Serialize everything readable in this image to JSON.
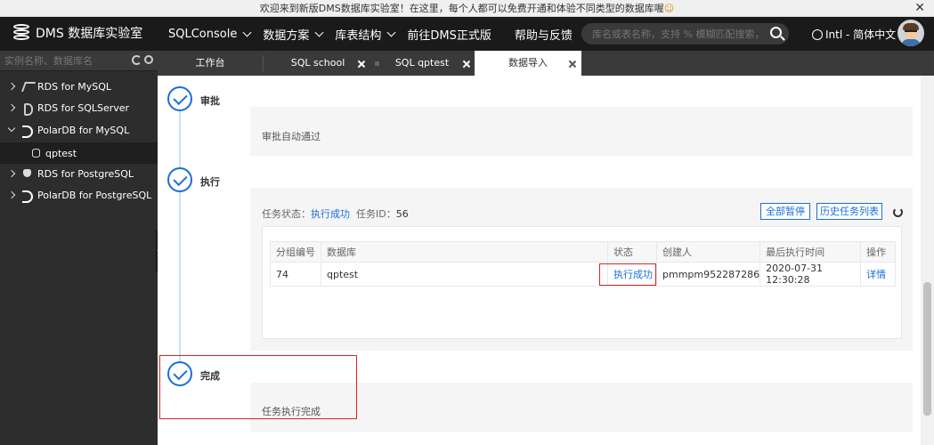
{
  "banner": {
    "text": "欢迎来到新版DMS数据库实验室！在这里，每个人都可以免费开通和体验不同类型的数据库喔",
    "emoji": "☺",
    "close": "✕"
  },
  "nav": {
    "logo": "DMS 数据库实验室",
    "items": [
      {
        "label": "SQLConsole"
      },
      {
        "label": "数据方案"
      },
      {
        "label": "库表结构"
      },
      {
        "label": "前往DMS正式版"
      },
      {
        "label": "帮助与反馈"
      }
    ],
    "search_placeholder": "库名或表名称，支持 % 模糊匹配搜索，如:c",
    "language": "Intl - 简体中文"
  },
  "sidebar": {
    "search_placeholder": "实例名称、数据库名",
    "items": [
      {
        "label": "RDS for MySQL",
        "icon": "mysql-icon"
      },
      {
        "label": "RDS for SQLServer",
        "icon": "sqlserver-icon"
      },
      {
        "label": "PolarDB for MySQL",
        "icon": "polardb-icon"
      },
      {
        "label": "qptest",
        "icon": "database-icon"
      },
      {
        "label": "RDS for PostgreSQL",
        "icon": "postgresql-icon"
      },
      {
        "label": "PolarDB for PostgreSQL",
        "icon": "polardb-icon"
      }
    ]
  },
  "tabs": [
    {
      "label": "工作台"
    },
    {
      "label": "SQL school"
    },
    {
      "label": "SQL qptest"
    },
    {
      "label": "数据导入"
    }
  ],
  "steps": {
    "approve": {
      "title": "审批",
      "text": "审批自动通过"
    },
    "execute": {
      "title": "执行",
      "status_label": "任务状态：",
      "status_value": "执行成功",
      "taskid_label": "任务ID：",
      "taskid_value": "56",
      "pause_all": "全部暂停",
      "history": "历史任务列表",
      "table": {
        "headers": [
          "分组编号",
          "数据库",
          "状态",
          "创建人",
          "最后执行时间",
          "操作"
        ],
        "rows": [
          {
            "group": "74",
            "db": "qptest",
            "status": "执行成功",
            "creator": "pmmpm952287286",
            "time": "2020-07-31 12:30:28",
            "action": "详情"
          }
        ]
      }
    },
    "done": {
      "title": "完成",
      "text": "任务执行完成"
    }
  },
  "colors": {
    "accent": "#1a6fd9",
    "highlight": "#e02020",
    "nav_bg": "#1a1a1a",
    "sidebar_bg": "#2d2d2d"
  }
}
